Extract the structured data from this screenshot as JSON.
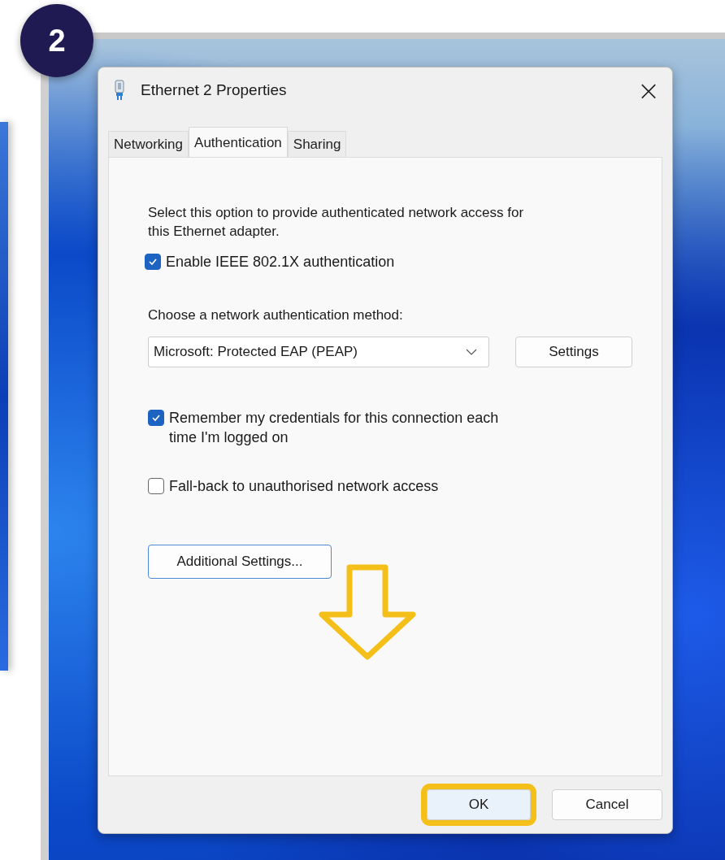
{
  "step_badge": "2",
  "dialog": {
    "title": "Ethernet 2 Properties",
    "close": "×"
  },
  "tabs": [
    {
      "label": "Networking",
      "selected": false
    },
    {
      "label": "Authentication",
      "selected": true
    },
    {
      "label": "Sharing",
      "selected": false
    }
  ],
  "description": "Select this option to provide authenticated network access for\nthis Ethernet adapter.",
  "enable_checkbox": {
    "label": "Enable IEEE 802.1X authentication",
    "checked": true
  },
  "method_label": "Choose a network authentication method:",
  "method_dropdown": {
    "value": "Microsoft: Protected EAP (PEAP)"
  },
  "settings_button": "Settings",
  "remember_checkbox": {
    "label": "Remember my credentials for this connection each\ntime I'm logged on",
    "checked": true
  },
  "fallback_checkbox": {
    "label": "Fall-back to unauthorised network access",
    "checked": false
  },
  "additional_settings_button": "Additional Settings...",
  "footer_buttons": [
    {
      "label": "OK",
      "highlighted": true
    },
    {
      "label": "Cancel",
      "highlighted": false
    }
  ]
}
